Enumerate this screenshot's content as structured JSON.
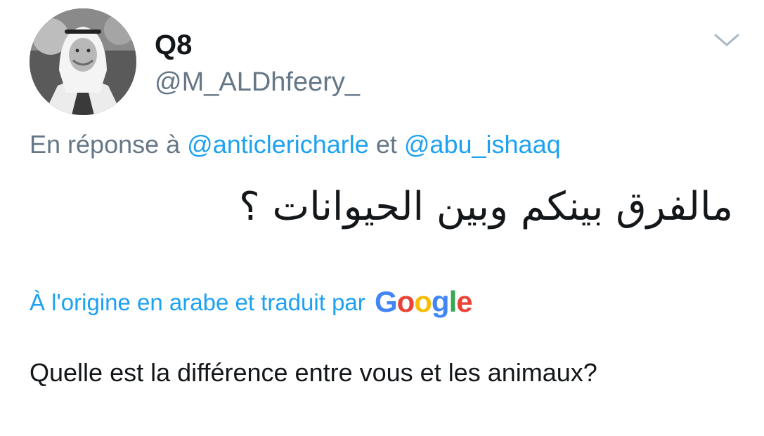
{
  "tweet": {
    "display_name": "Q8",
    "handle": "@M_ALDhfeery_",
    "reply_prefix": "En réponse à",
    "reply_mention_1": "@anticlericharle",
    "reply_joiner": "et",
    "reply_mention_2": "@abu_ishaaq",
    "original_text": "مالفرق بينكم وبين الحيوانات ؟",
    "translated_by_label": "À l'origine en arabe et traduit par",
    "translated_text": "Quelle est la différence entre vous et les animaux?"
  },
  "google_logo": {
    "letters": [
      "G",
      "o",
      "o",
      "g",
      "l",
      "e"
    ],
    "colors": [
      "#4285f4",
      "#ea4335",
      "#fbbc05",
      "#4285f4",
      "#34a853",
      "#ea4335"
    ]
  },
  "icons": {
    "menu": "chevron-down-icon",
    "avatar": "profile-photo"
  },
  "colors": {
    "link": "#1da1f2",
    "secondary_text": "#657786",
    "primary_text": "#14171a"
  }
}
